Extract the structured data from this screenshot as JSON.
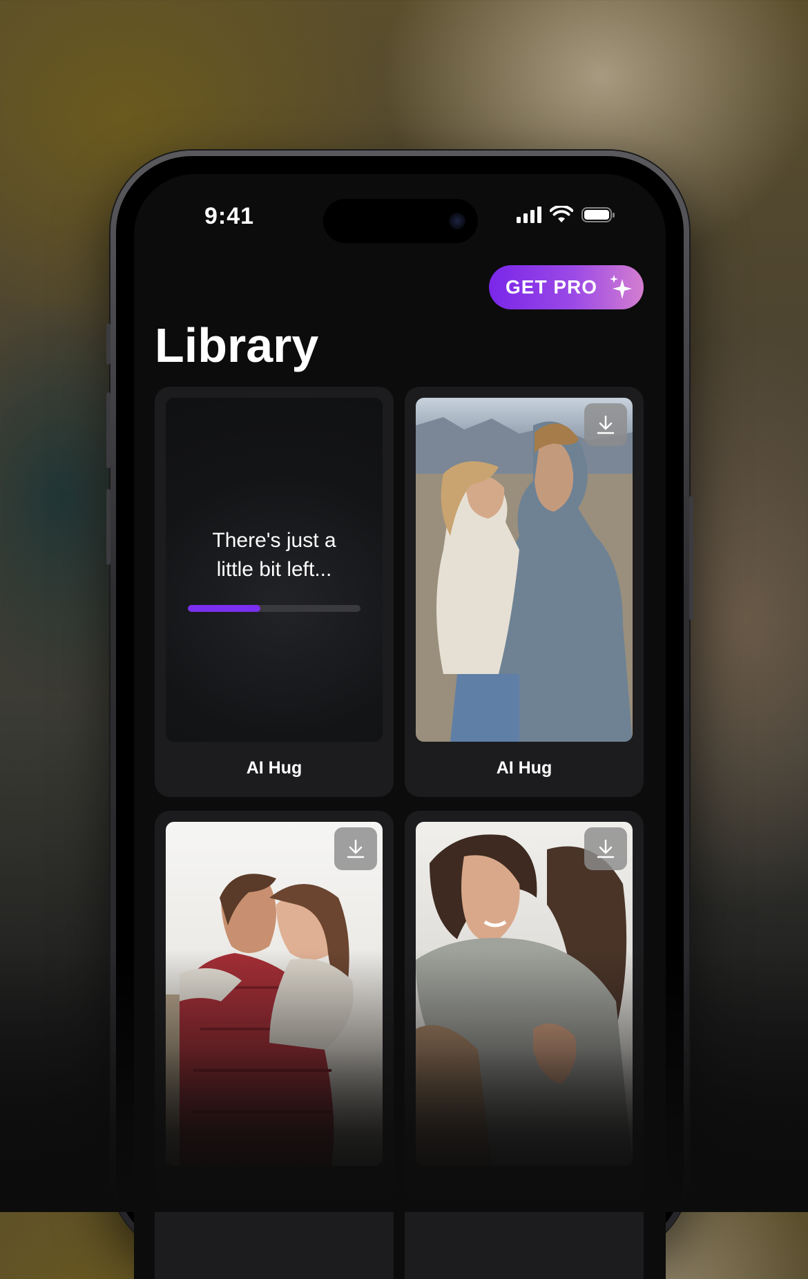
{
  "status_bar": {
    "time": "9:41"
  },
  "header": {
    "get_pro_label": "GET PRO",
    "get_pro_icon": "sparkle-icon"
  },
  "page": {
    "title": "Library"
  },
  "cards": [
    {
      "label": "AI Hug",
      "state": "loading",
      "loading_text": "There's just a little bit left...",
      "progress": 0.42
    },
    {
      "label": "AI Hug",
      "state": "done",
      "action_icon": "download-icon"
    },
    {
      "label": "",
      "state": "done",
      "action_icon": "download-icon"
    },
    {
      "label": "",
      "state": "done",
      "action_icon": "download-icon"
    }
  ],
  "colors": {
    "accent": "#7B2FF0",
    "pro_gradient_start": "#7A26E8",
    "pro_gradient_end": "#D47ED0",
    "card_bg": "#1C1C1E",
    "screen_bg": "#0C0C0C"
  }
}
